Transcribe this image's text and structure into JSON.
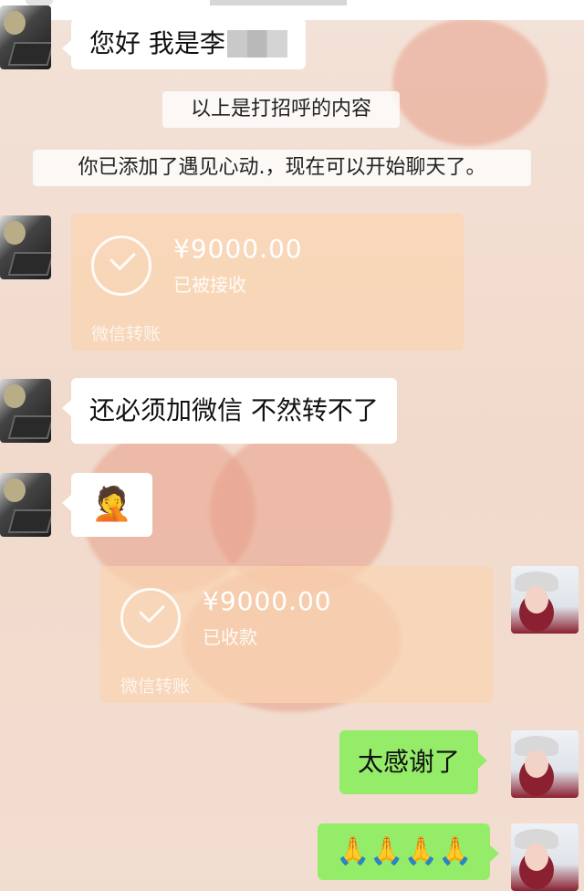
{
  "messages": {
    "greeting": "您好 我是李",
    "system_notice_1": "以上是打招呼的内容",
    "system_notice_2": "你已添加了遇见心动.，现在可以开始聊天了。",
    "transfer_1": {
      "amount": "¥9000.00",
      "status": "已被接收",
      "footer": "微信转账"
    },
    "msg_need_wechat": "还必须加微信 不然转不了",
    "emoji_facepalm": "🤦",
    "transfer_2": {
      "amount": "¥9000.00",
      "status": "已收款",
      "footer": "微信转账"
    },
    "msg_thanks": "太感谢了",
    "emoji_pray": "🙏🙏🙏🙏"
  },
  "icons": {
    "transfer_check": "check-circle-icon"
  },
  "colors": {
    "self_bubble": "#95ec69",
    "other_bubble": "#ffffff",
    "transfer_card": "#f9d4b1"
  }
}
